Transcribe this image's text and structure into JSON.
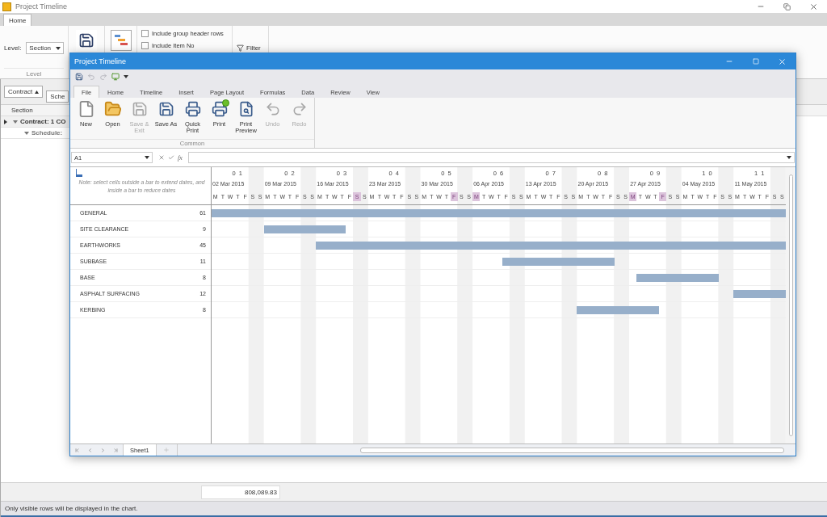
{
  "app": {
    "title": "Project Timeline",
    "tabs": [
      {
        "label": "Home",
        "selected": true
      }
    ],
    "ribbon": {
      "level_label": "Level:",
      "level_value": "Section",
      "level_group": "Level",
      "buttons": [
        {
          "kind": "save"
        },
        {
          "kind": "chart"
        }
      ],
      "options": [
        {
          "label": "Include group header rows",
          "checked": false
        },
        {
          "label": "Include Item No",
          "checked": false
        }
      ],
      "filter": "Filter"
    },
    "group_chips": [
      {
        "label": "Contract",
        "sorted": true
      },
      {
        "label": "Sche",
        "sorted": false
      }
    ],
    "grid": {
      "column": "Section",
      "rows": [
        {
          "label": "Contract: 1 CO",
          "current": true,
          "expanded": true,
          "children": [
            {
              "label": "Schedule:",
              "current": false,
              "expanded": true
            }
          ]
        }
      ]
    },
    "total": "808,089.83",
    "status": "Only visible rows will be displayed in the chart."
  },
  "window": {
    "title": "Project Timeline",
    "quick_access": [
      {
        "kind": "save",
        "disabled": false
      },
      {
        "kind": "undo",
        "disabled": true
      },
      {
        "kind": "redo",
        "disabled": true
      },
      {
        "kind": "device",
        "disabled": false
      },
      {
        "kind": "customize",
        "disabled": false
      }
    ],
    "tabs": [
      {
        "label": "File",
        "selected": true
      },
      {
        "label": "Home",
        "selected": false
      },
      {
        "label": "Timeline",
        "selected": false
      },
      {
        "label": "Insert",
        "selected": false
      },
      {
        "label": "Page Layout",
        "selected": false
      },
      {
        "label": "Formulas",
        "selected": false
      },
      {
        "label": "Data",
        "selected": false
      },
      {
        "label": "Review",
        "selected": false
      },
      {
        "label": "View",
        "selected": false
      }
    ],
    "ribbon_buttons": [
      {
        "kind": "new",
        "label": "New",
        "disabled": false
      },
      {
        "kind": "open",
        "label": "Open",
        "disabled": false
      },
      {
        "kind": "save-exit",
        "label": "Save & Exit",
        "disabled": true
      },
      {
        "kind": "save-as",
        "label": "Save As",
        "disabled": false
      },
      {
        "kind": "quick-print",
        "label": "Quick Print",
        "disabled": false
      },
      {
        "kind": "print",
        "label": "Print",
        "disabled": false
      },
      {
        "kind": "preview",
        "label": "Print Preview",
        "disabled": false
      },
      {
        "kind": "undo",
        "label": "Undo",
        "disabled": true
      },
      {
        "kind": "redo",
        "label": "Redo",
        "disabled": true
      }
    ],
    "ribbon_group": "Common",
    "name_box": "A1",
    "function_button": "fx",
    "note": "Note: select cells outside a bar to extend dates, and inside a bar to reduce dates",
    "timeline": {
      "weeks": [
        {
          "number": "0 1",
          "date": "02 Mar 2015",
          "days": [
            {
              "letter": "M",
              "marked": false
            },
            {
              "letter": "T",
              "marked": false
            },
            {
              "letter": "W",
              "marked": false
            },
            {
              "letter": "T",
              "marked": false
            },
            {
              "letter": "F",
              "marked": false
            },
            {
              "letter": "S",
              "marked": false
            },
            {
              "letter": "S",
              "marked": false
            }
          ]
        },
        {
          "number": "0 2",
          "date": "09 Mar 2015",
          "days": [
            {
              "letter": "M",
              "marked": false
            },
            {
              "letter": "T",
              "marked": false
            },
            {
              "letter": "W",
              "marked": false
            },
            {
              "letter": "T",
              "marked": false
            },
            {
              "letter": "F",
              "marked": false
            },
            {
              "letter": "S",
              "marked": false
            },
            {
              "letter": "S",
              "marked": false
            }
          ]
        },
        {
          "number": "0 3",
          "date": "16 Mar 2015",
          "days": [
            {
              "letter": "M",
              "marked": false
            },
            {
              "letter": "T",
              "marked": false
            },
            {
              "letter": "W",
              "marked": false
            },
            {
              "letter": "T",
              "marked": false
            },
            {
              "letter": "F",
              "marked": false
            },
            {
              "letter": "S",
              "marked": true
            },
            {
              "letter": "S",
              "marked": false
            }
          ]
        },
        {
          "number": "0 4",
          "date": "23 Mar 2015",
          "days": [
            {
              "letter": "M",
              "marked": false
            },
            {
              "letter": "T",
              "marked": false
            },
            {
              "letter": "W",
              "marked": false
            },
            {
              "letter": "T",
              "marked": false
            },
            {
              "letter": "F",
              "marked": false
            },
            {
              "letter": "S",
              "marked": false
            },
            {
              "letter": "S",
              "marked": false
            }
          ]
        },
        {
          "number": "0 5",
          "date": "30 Mar 2015",
          "days": [
            {
              "letter": "M",
              "marked": false
            },
            {
              "letter": "T",
              "marked": false
            },
            {
              "letter": "W",
              "marked": false
            },
            {
              "letter": "T",
              "marked": false
            },
            {
              "letter": "F",
              "marked": true
            },
            {
              "letter": "S",
              "marked": false
            },
            {
              "letter": "S",
              "marked": false
            }
          ]
        },
        {
          "number": "0 6",
          "date": "06 Apr 2015",
          "days": [
            {
              "letter": "M",
              "marked": true
            },
            {
              "letter": "T",
              "marked": false
            },
            {
              "letter": "W",
              "marked": false
            },
            {
              "letter": "T",
              "marked": false
            },
            {
              "letter": "F",
              "marked": false
            },
            {
              "letter": "S",
              "marked": false
            },
            {
              "letter": "S",
              "marked": false
            }
          ]
        },
        {
          "number": "0 7",
          "date": "13 Apr 2015",
          "days": [
            {
              "letter": "M",
              "marked": false
            },
            {
              "letter": "T",
              "marked": false
            },
            {
              "letter": "W",
              "marked": false
            },
            {
              "letter": "T",
              "marked": false
            },
            {
              "letter": "F",
              "marked": false
            },
            {
              "letter": "S",
              "marked": false
            },
            {
              "letter": "S",
              "marked": false
            }
          ]
        },
        {
          "number": "0 8",
          "date": "20 Apr 2015",
          "days": [
            {
              "letter": "M",
              "marked": false
            },
            {
              "letter": "T",
              "marked": false
            },
            {
              "letter": "W",
              "marked": false
            },
            {
              "letter": "T",
              "marked": false
            },
            {
              "letter": "F",
              "marked": false
            },
            {
              "letter": "S",
              "marked": false
            },
            {
              "letter": "S",
              "marked": false
            }
          ]
        },
        {
          "number": "0 9",
          "date": "27 Apr 2015",
          "days": [
            {
              "letter": "M",
              "marked": true
            },
            {
              "letter": "T",
              "marked": false
            },
            {
              "letter": "W",
              "marked": false
            },
            {
              "letter": "T",
              "marked": false
            },
            {
              "letter": "F",
              "marked": true
            },
            {
              "letter": "S",
              "marked": false
            },
            {
              "letter": "S",
              "marked": false
            }
          ]
        },
        {
          "number": "1 0",
          "date": "04 May 2015",
          "days": [
            {
              "letter": "M",
              "marked": false
            },
            {
              "letter": "T",
              "marked": false
            },
            {
              "letter": "W",
              "marked": false
            },
            {
              "letter": "T",
              "marked": false
            },
            {
              "letter": "F",
              "marked": false
            },
            {
              "letter": "S",
              "marked": false
            },
            {
              "letter": "S",
              "marked": false
            }
          ]
        },
        {
          "number": "1 1",
          "date": "11 May 2015",
          "days": [
            {
              "letter": "M",
              "marked": false
            },
            {
              "letter": "T",
              "marked": false
            },
            {
              "letter": "W",
              "marked": false
            },
            {
              "letter": "T",
              "marked": false
            },
            {
              "letter": "F",
              "marked": false
            },
            {
              "letter": "S",
              "marked": false
            },
            {
              "letter": "S",
              "marked": false
            }
          ]
        }
      ]
    },
    "tasks": [
      {
        "name": "GENERAL",
        "count": "61"
      },
      {
        "name": "SITE CLEARANCE",
        "count": "9"
      },
      {
        "name": "EARTHWORKS",
        "count": "45"
      },
      {
        "name": "SUBBASE",
        "count": "11"
      },
      {
        "name": "BASE",
        "count": "8"
      },
      {
        "name": "ASPHALT SURFACING",
        "count": "12"
      },
      {
        "name": "KERBING",
        "count": "8"
      }
    ],
    "sheet_tabs": [
      {
        "label": "Sheet1",
        "selected": true
      }
    ]
  }
}
